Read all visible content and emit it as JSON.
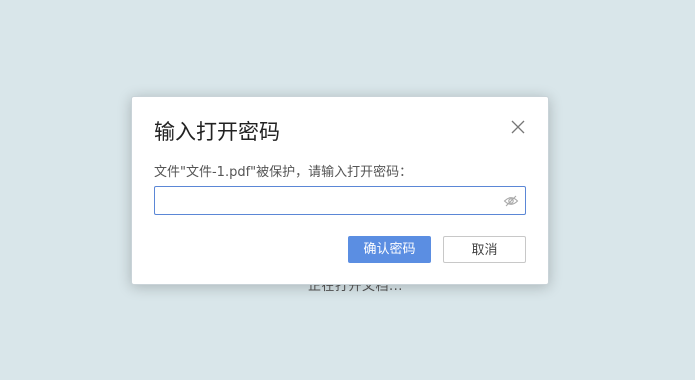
{
  "background": {
    "status_text": "正在打开文档..."
  },
  "dialog": {
    "title": "输入打开密码",
    "prompt": "文件\"文件-1.pdf\"被保护，请输入打开密码：",
    "password_value": "",
    "confirm_label": "确认密码",
    "cancel_label": "取消",
    "icons": {
      "close": "close-icon",
      "visibility": "eye-off-icon"
    }
  },
  "colors": {
    "accent": "#5b8ee2",
    "input_border": "#5b87d6",
    "background": "#d9e6ea"
  }
}
